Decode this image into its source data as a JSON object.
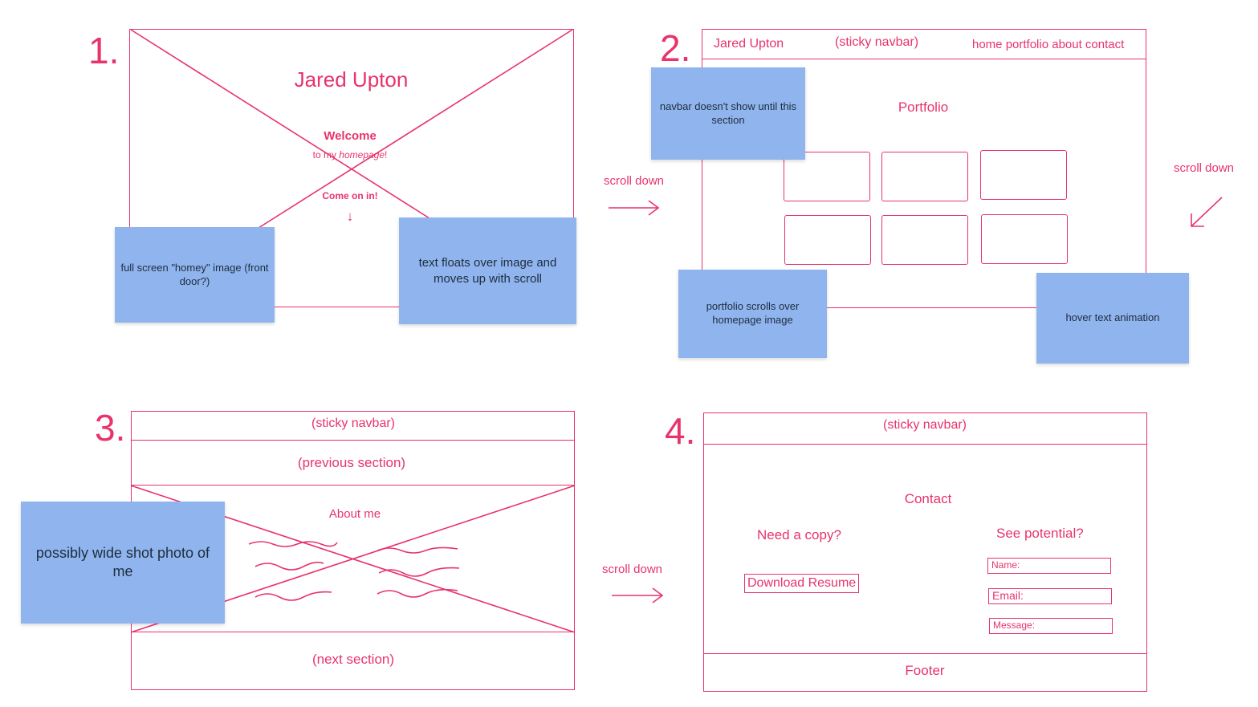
{
  "numbers": [
    "1.",
    "2.",
    "3.",
    "4."
  ],
  "scroll_label": "scroll down",
  "frame1": {
    "name": "Jared Upton",
    "welcome": "Welcome",
    "to_my_prefix": "to my ",
    "homepage_word": "homepage",
    "to_my_suffix": "!",
    "come_on_in": "Come on in!",
    "arrow": "↓"
  },
  "frame2": {
    "nav_name": "Jared Upton",
    "nav_sticky": "(sticky navbar)",
    "nav_links": "home portfolio about contact",
    "section_title": "Portfolio"
  },
  "frame3": {
    "nav_sticky": "(sticky navbar)",
    "previous": "(previous section)",
    "about": "About me",
    "next": "(next section)"
  },
  "frame4": {
    "nav_sticky": "(sticky navbar)",
    "contact": "Contact",
    "need_copy": "Need a copy?",
    "download": "Download Resume",
    "see_potential": "See potential?",
    "name_field": "Name:",
    "email_field": "Email:",
    "message_field": "Message:",
    "footer": "Footer"
  },
  "notes": {
    "homey_image": "full screen \"homey\" image (front door?)",
    "text_floats": "text floats over image and moves up with scroll",
    "navbar_hidden": "navbar doesn't show until this section",
    "portfolio_scrolls": "portfolio scrolls over homepage image",
    "hover_animation": "hover text animation",
    "wide_shot": "possibly wide shot photo of me"
  },
  "colors": {
    "ink": "#e8336b",
    "sticky_note": "#8fb4ee"
  }
}
